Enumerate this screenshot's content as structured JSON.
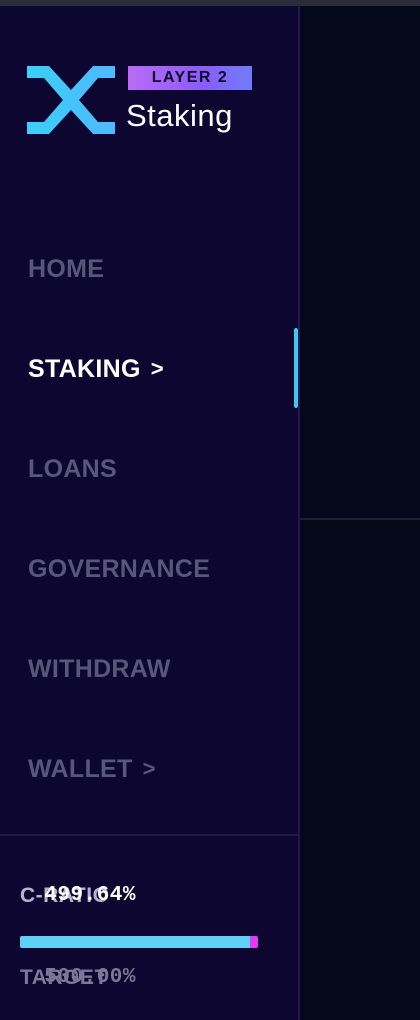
{
  "logo": {
    "badge": "LAYER 2",
    "title": "Staking"
  },
  "nav": {
    "items": [
      {
        "label": "HOME",
        "active": false,
        "chevron": ""
      },
      {
        "label": "STAKING",
        "active": true,
        "chevron": ">"
      },
      {
        "label": "LOANS",
        "active": false,
        "chevron": ""
      },
      {
        "label": "GOVERNANCE",
        "active": false,
        "chevron": ""
      },
      {
        "label": "WITHDRAW",
        "active": false,
        "chevron": ""
      },
      {
        "label": "WALLET",
        "active": false,
        "chevron": ">"
      }
    ]
  },
  "stats": {
    "c_ratio_label": "C-RATIO",
    "c_ratio_value": "499.64%",
    "target_label": "TARGET",
    "target_value": "500.00%",
    "current_ratio_percent": 499.64,
    "target_ratio_percent": 500.0
  },
  "colors": {
    "accent": "#3ec7f5",
    "bar_fill": "#5fd1f6",
    "bar_target": "#e13cf0",
    "badge_gradient_start": "#b96bf5",
    "sidebar_bg": "#0c0631"
  }
}
